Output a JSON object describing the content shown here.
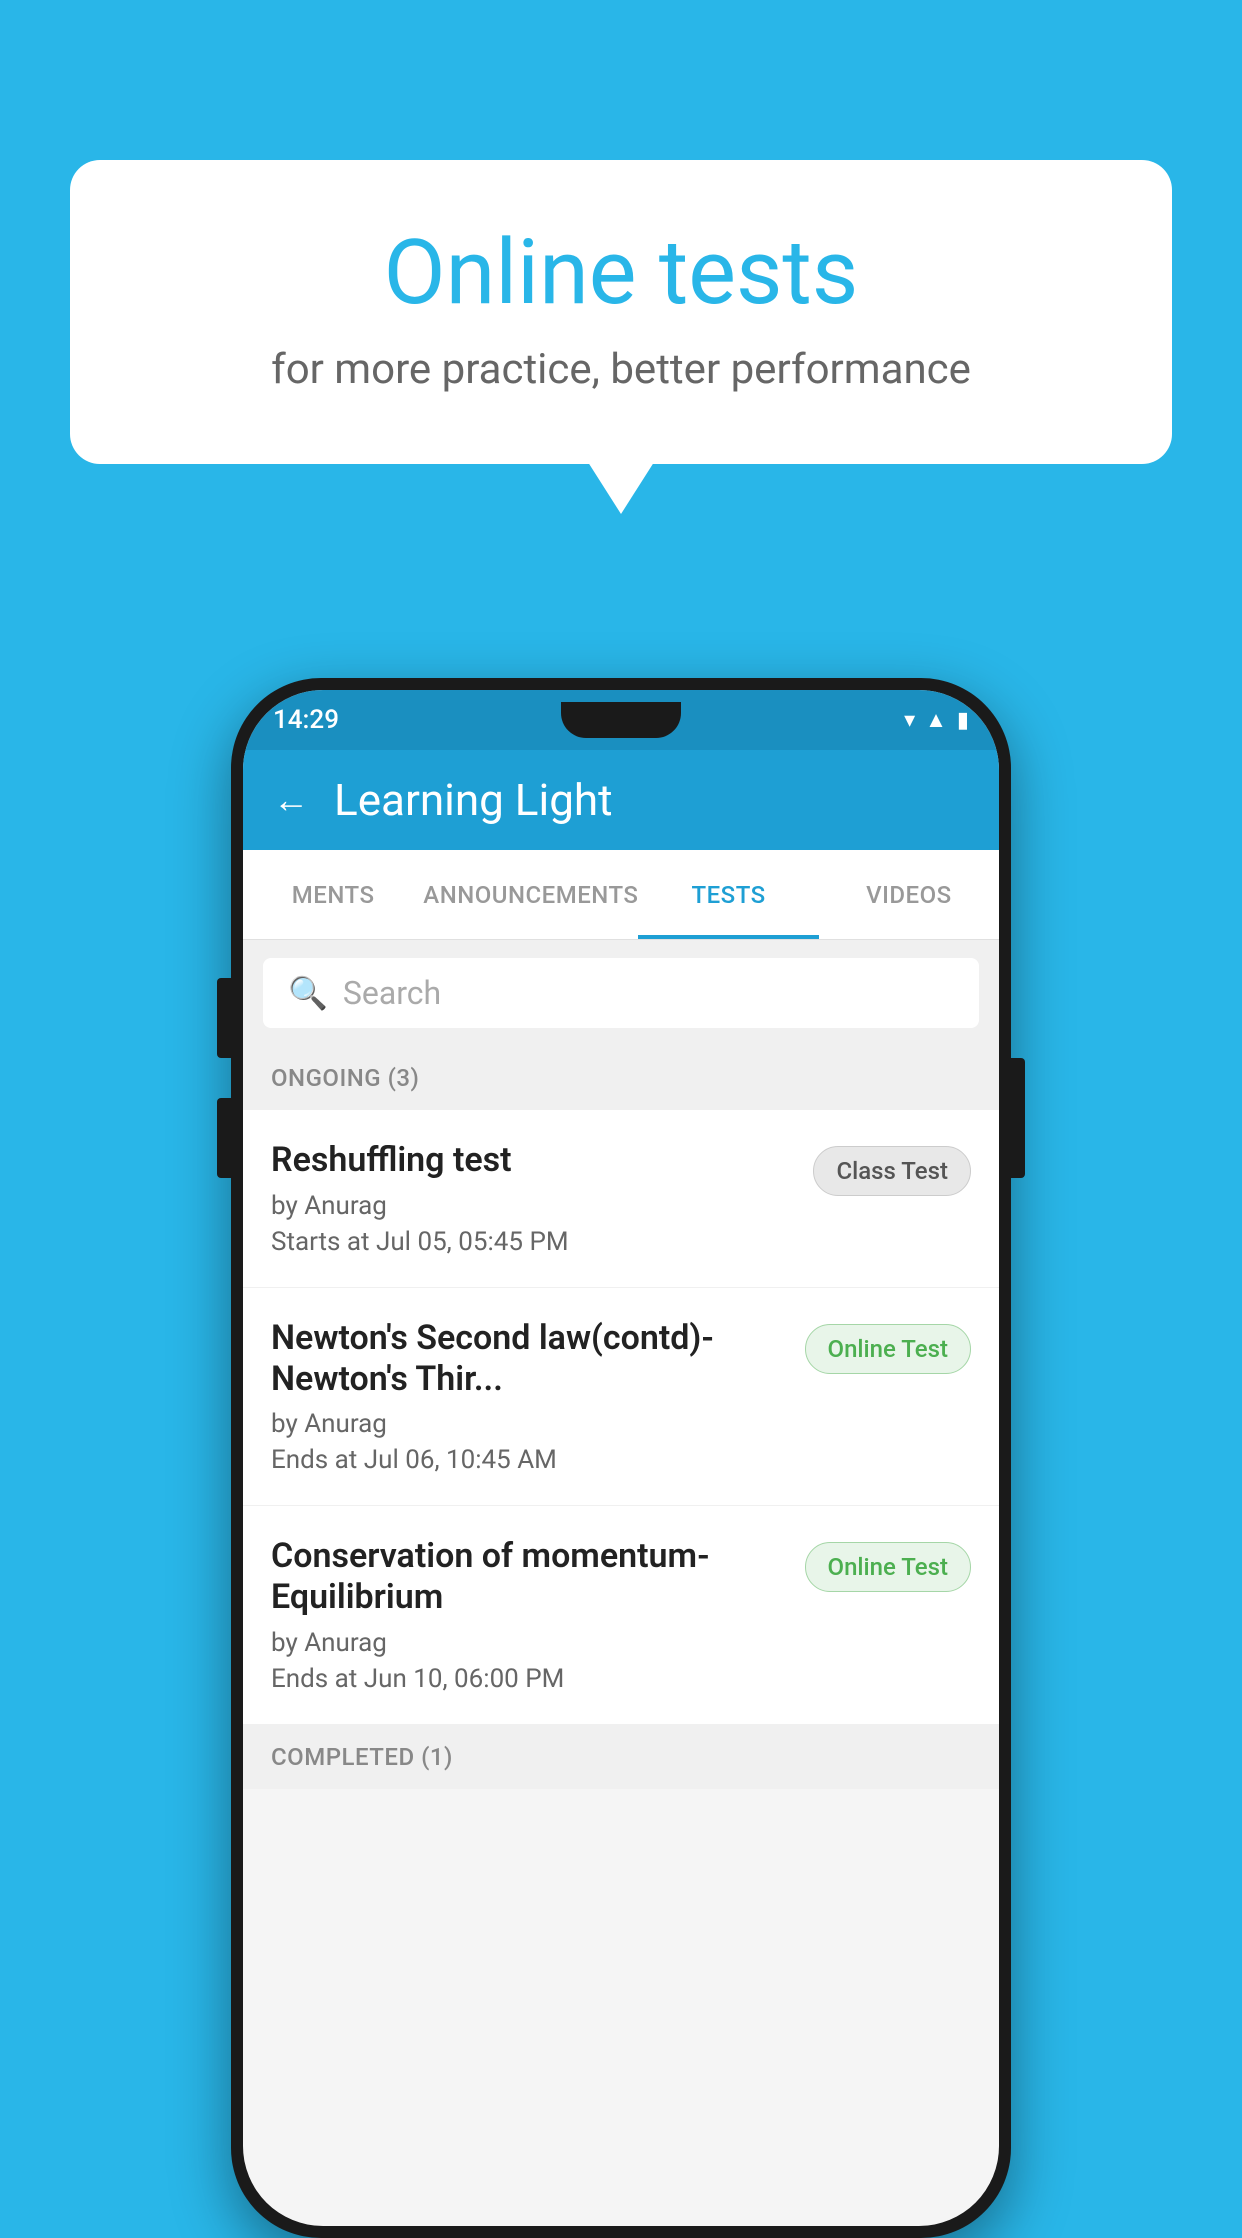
{
  "background_color": "#29b6e8",
  "speech_bubble": {
    "title": "Online tests",
    "subtitle": "for more practice, better performance"
  },
  "phone": {
    "status_bar": {
      "time": "14:29",
      "icons": [
        "wifi",
        "signal",
        "battery"
      ]
    },
    "app_bar": {
      "title": "Learning Light",
      "back_label": "←"
    },
    "tabs": [
      {
        "label": "MENTS",
        "active": false
      },
      {
        "label": "ANNOUNCEMENTS",
        "active": false
      },
      {
        "label": "TESTS",
        "active": true
      },
      {
        "label": "VIDEOS",
        "active": false
      }
    ],
    "search": {
      "placeholder": "Search",
      "icon": "🔍"
    },
    "sections": [
      {
        "label": "ONGOING (3)",
        "tests": [
          {
            "name": "Reshuffling test",
            "author": "by Anurag",
            "time": "Starts at  Jul 05, 05:45 PM",
            "badge": "Class Test",
            "badge_type": "class"
          },
          {
            "name": "Newton's Second law(contd)-Newton's Thir...",
            "author": "by Anurag",
            "time": "Ends at  Jul 06, 10:45 AM",
            "badge": "Online Test",
            "badge_type": "online"
          },
          {
            "name": "Conservation of momentum-Equilibrium",
            "author": "by Anurag",
            "time": "Ends at  Jun 10, 06:00 PM",
            "badge": "Online Test",
            "badge_type": "online"
          }
        ]
      }
    ],
    "completed_label": "COMPLETED (1)"
  }
}
